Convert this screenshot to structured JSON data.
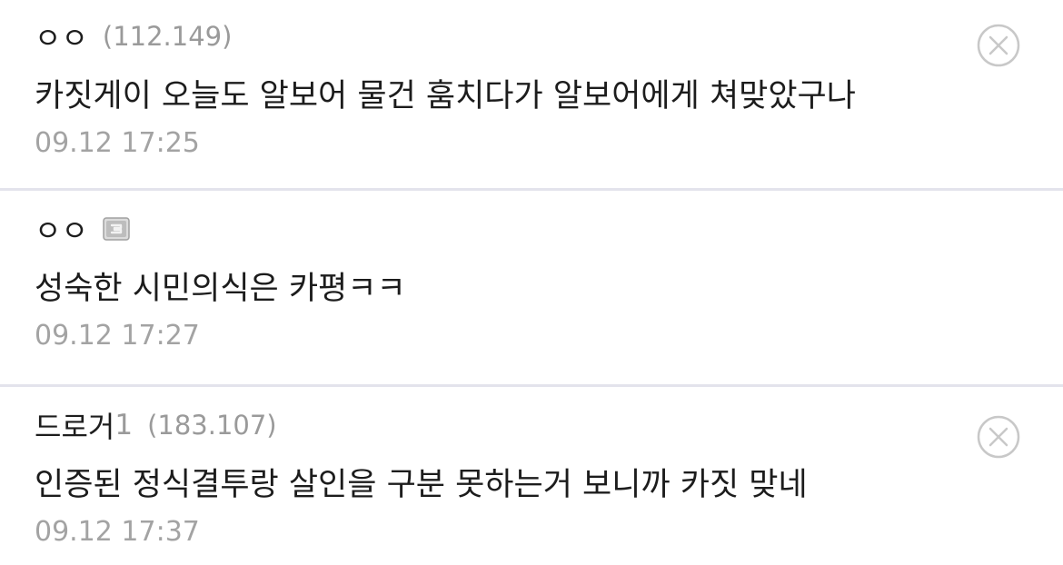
{
  "comments": [
    {
      "nickname": "ㅇㅇ",
      "nick_suffix": "",
      "ip": "(112.149)",
      "body": "카짓게이 오늘도 알보어 물건 훔치다가 알보어에게 쳐맞았구나",
      "timestamp": "09.12 17:25",
      "has_delete": true,
      "icon": "close-circle-icon"
    },
    {
      "nickname": "ㅇㅇ",
      "nick_suffix": "",
      "ip": "",
      "body": "성숙한 시민의식은 카평ㅋㅋ",
      "timestamp": "09.12 17:27",
      "has_delete": false,
      "icon": "gallog-icon"
    },
    {
      "nickname": "드로거",
      "nick_suffix": "1",
      "ip": "(183.107)",
      "body": "인증된 정식결투랑 살인을 구분 못하는거 보니까 카짓 맞네",
      "timestamp": "09.12 17:37",
      "has_delete": true,
      "icon": "close-circle-icon"
    }
  ],
  "colors": {
    "divider": "#e3e3ec",
    "meta_gray": "#9a9a9a",
    "text": "#1c1c1c"
  }
}
